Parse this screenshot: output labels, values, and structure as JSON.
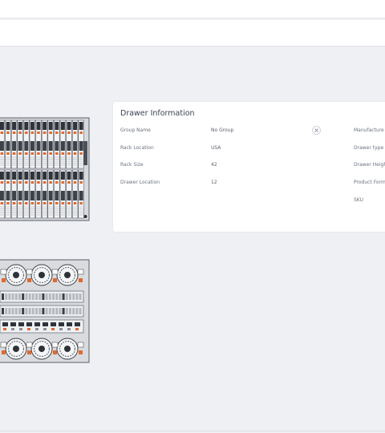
{
  "drawer_info": {
    "title": "Drawer Information",
    "left_fields": [
      {
        "label": "Group Name",
        "value": "No Group"
      },
      {
        "label": "Rack Location",
        "value": "USA"
      },
      {
        "label": "Rack Size",
        "value": "42"
      },
      {
        "label": "Drawer Location",
        "value": "12"
      }
    ],
    "right_labels": [
      "Manufacture",
      "Drawer type",
      "Drawer Heigh",
      "Product Form",
      "SKU"
    ]
  },
  "icons": {
    "close": "close-icon"
  },
  "colors": {
    "page_bg": "#eff0f4",
    "card_bg": "#ffffff",
    "accent_orange": "#e0692e",
    "rack_metal": "#c9cbd0"
  }
}
